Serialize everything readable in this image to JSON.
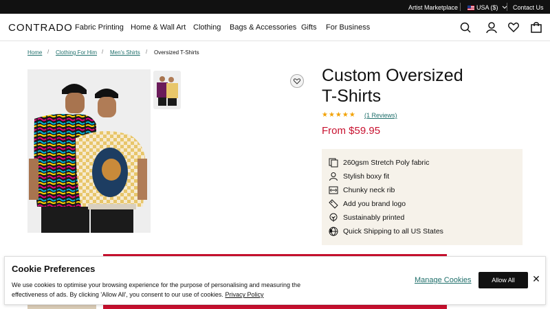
{
  "topbar": {
    "artist_marketplace": "Artist Marketplace",
    "currency": "USA ($)",
    "contact": "Contact Us"
  },
  "nav": {
    "logo": "CONTRADO",
    "links": [
      "Fabric Printing",
      "Home & Wall Art",
      "Clothing",
      "Bags & Accessories",
      "Gifts",
      "For Business"
    ],
    "icons": [
      "search-icon",
      "account-icon",
      "heart-icon",
      "bag-icon"
    ]
  },
  "breadcrumb": [
    "Home",
    "Clothing For Him",
    "Men's Shirts",
    "Oversized T-Shirts"
  ],
  "product": {
    "title_line1": "Custom Oversized",
    "title_line2": "T-Shirts",
    "rating_stars": 5,
    "stars_text": "★★★★★",
    "reviews": "(1 Reviews)",
    "price": "From $59.95",
    "features": [
      {
        "icon": "fabric-icon",
        "text": "260gsm Stretch Poly fabric"
      },
      {
        "icon": "person-icon",
        "text": "Stylish boxy fit"
      },
      {
        "icon": "neck-rib-icon",
        "text": "Chunky neck rib"
      },
      {
        "icon": "tag-icon",
        "text": "Add you brand logo"
      },
      {
        "icon": "eco-icon",
        "text": "Sustainably printed"
      },
      {
        "icon": "globe-icon",
        "text": "Quick Shipping to all US States"
      }
    ]
  },
  "cookie": {
    "title": "Cookie Preferences",
    "text": "We use cookies to optimise your browsing experience for the purpose of personalising and measuring the effectiveness of ads. By clicking 'Allow All', you consent to our use of cookies.",
    "policy_link": "Privacy Policy",
    "manage": "Manage Cookies",
    "allow": "Allow All",
    "close": "✕"
  },
  "colors": {
    "accent_red": "#c8102e",
    "link_teal": "#1f6f6b",
    "star": "#f2a100",
    "feature_bg": "#f6f2ea"
  }
}
